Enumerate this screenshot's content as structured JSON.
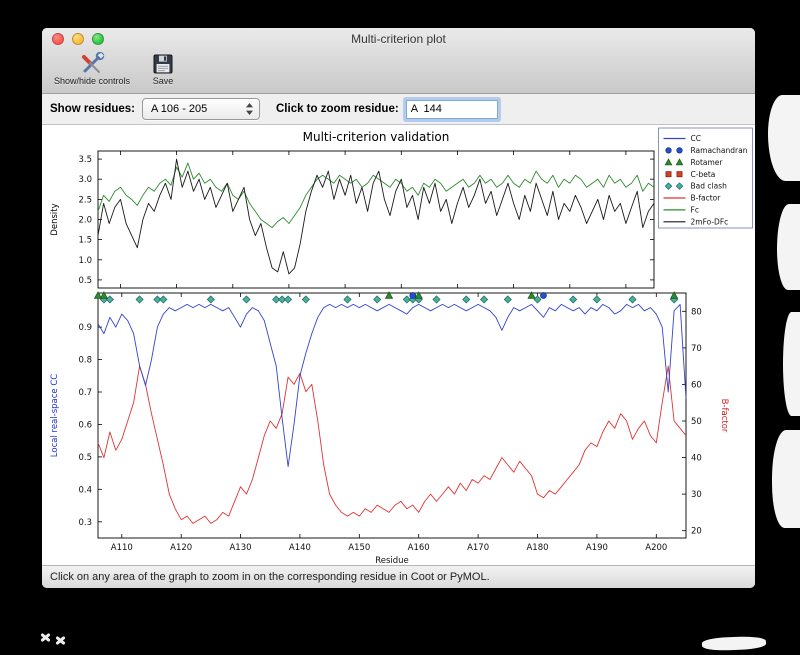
{
  "window": {
    "title": "Multi-criterion plot",
    "status_bar": "Click on any area of the graph to zoom in on the corresponding residue in Coot or PyMOL."
  },
  "toolbar": {
    "show_hide_label": "Show/hide controls",
    "save_label": "Save"
  },
  "icons": {
    "show_hide": "crossed-tools-icon",
    "save": "floppy-disk-icon",
    "popup_stepper": "up-down-chevrons"
  },
  "controls": {
    "show_residues_label": "Show residues:",
    "residue_range_value": "A 106 - 205",
    "zoom_residue_label": "Click to zoom residue:",
    "zoom_residue_value": "A  144"
  },
  "chart_data": {
    "type": "line",
    "title": "Multi-criterion validation",
    "xlabel": "Residue",
    "x_range": [
      106,
      205
    ],
    "x_tick_values": [
      110,
      120,
      130,
      140,
      150,
      160,
      170,
      180,
      190,
      200
    ],
    "x_ticks": [
      "A110",
      "A120",
      "A130",
      "A140",
      "A150",
      "A160",
      "A170",
      "A180",
      "A190",
      "A200"
    ],
    "top_plot": {
      "ylabel": "Density",
      "ylim": [
        0.3,
        3.7
      ],
      "yticks": [
        0.5,
        1.0,
        1.5,
        2.0,
        2.5,
        3.0,
        3.5
      ],
      "series": [
        {
          "name": "Fc",
          "color": "#2e8b2e",
          "values": [
            2.2,
            2.6,
            2.45,
            2.7,
            2.8,
            2.6,
            2.5,
            2.35,
            2.6,
            2.8,
            2.7,
            2.9,
            3.0,
            2.85,
            3.3,
            3.05,
            3.4,
            3.0,
            3.15,
            2.9,
            3.0,
            2.8,
            2.7,
            2.9,
            2.6,
            2.5,
            2.7,
            2.4,
            2.2,
            2.0,
            1.9,
            1.8,
            1.95,
            2.05,
            1.9,
            2.1,
            2.3,
            2.6,
            2.8,
            3.0,
            3.1,
            3.0,
            2.9,
            3.1,
            3.0,
            2.9,
            3.0,
            2.8,
            2.9,
            3.1,
            3.0,
            2.9,
            2.8,
            3.0,
            2.9,
            2.7,
            2.8,
            2.6,
            2.9,
            2.8,
            3.0,
            2.9,
            2.7,
            2.8,
            2.9,
            3.0,
            2.8,
            2.9,
            3.1,
            2.9,
            3.0,
            2.8,
            2.9,
            3.1,
            2.9,
            2.8,
            3.0,
            2.9,
            3.2,
            3.0,
            2.9,
            3.1,
            2.8,
            3.0,
            2.9,
            3.1,
            3.0,
            2.8,
            2.9,
            3.0,
            2.8,
            3.1,
            2.9,
            3.0,
            2.8,
            2.9,
            3.1,
            2.7,
            2.9,
            2.8
          ]
        },
        {
          "name": "2mFo-DFc",
          "color": "#1a1a1a",
          "values": [
            1.6,
            2.4,
            1.9,
            2.3,
            2.5,
            1.9,
            1.6,
            1.3,
            2.0,
            2.4,
            2.2,
            2.6,
            2.9,
            2.5,
            3.5,
            2.8,
            3.2,
            2.7,
            3.0,
            2.5,
            2.8,
            2.3,
            2.6,
            2.9,
            2.2,
            2.5,
            2.8,
            2.0,
            1.6,
            1.9,
            1.3,
            0.8,
            0.7,
            1.2,
            0.65,
            0.8,
            1.4,
            2.2,
            2.7,
            3.1,
            2.8,
            3.2,
            2.5,
            3.0,
            2.6,
            3.1,
            2.4,
            2.8,
            2.2,
            2.9,
            3.2,
            2.5,
            2.1,
            2.7,
            3.0,
            2.3,
            2.6,
            2.0,
            2.8,
            2.4,
            2.9,
            2.2,
            2.5,
            1.9,
            2.4,
            2.8,
            2.3,
            2.6,
            3.0,
            2.4,
            2.7,
            2.1,
            2.5,
            2.9,
            2.4,
            2.0,
            2.6,
            2.2,
            2.9,
            2.5,
            2.1,
            2.7,
            2.0,
            2.4,
            2.2,
            2.6,
            2.3,
            1.9,
            2.2,
            2.5,
            2.0,
            2.6,
            2.2,
            2.4,
            1.9,
            2.3,
            2.7,
            1.8,
            2.2,
            2.4
          ]
        }
      ]
    },
    "bottom_plot": {
      "ylabel_left": "Local real-space CC",
      "ylabel_left_color": "#2233cc",
      "ylim_left": [
        0.25,
        1.005
      ],
      "yticks_left": [
        0.3,
        0.4,
        0.5,
        0.6,
        0.7,
        0.8,
        0.9
      ],
      "ylabel_right": "B-factor",
      "ylabel_right_color": "#cc2222",
      "ylim_right": [
        18,
        85
      ],
      "yticks_right": [
        20,
        30,
        40,
        50,
        60,
        70,
        80
      ],
      "cc": {
        "name": "CC",
        "color": "#3344cc",
        "values": [
          0.91,
          0.88,
          0.93,
          0.9,
          0.94,
          0.92,
          0.88,
          0.78,
          0.72,
          0.8,
          0.9,
          0.94,
          0.96,
          0.95,
          0.96,
          0.97,
          0.96,
          0.97,
          0.96,
          0.97,
          0.96,
          0.95,
          0.96,
          0.93,
          0.9,
          0.94,
          0.96,
          0.95,
          0.92,
          0.85,
          0.78,
          0.62,
          0.47,
          0.6,
          0.75,
          0.82,
          0.88,
          0.93,
          0.96,
          0.97,
          0.96,
          0.97,
          0.96,
          0.97,
          0.96,
          0.97,
          0.96,
          0.95,
          0.96,
          0.97,
          0.96,
          0.95,
          0.94,
          0.96,
          0.97,
          0.96,
          0.95,
          0.96,
          0.97,
          0.96,
          0.97,
          0.96,
          0.95,
          0.96,
          0.97,
          0.96,
          0.95,
          0.93,
          0.89,
          0.93,
          0.96,
          0.95,
          0.96,
          0.97,
          0.95,
          0.93,
          0.96,
          0.95,
          0.97,
          0.96,
          0.95,
          0.96,
          0.94,
          0.96,
          0.95,
          0.97,
          0.96,
          0.94,
          0.95,
          0.97,
          0.96,
          0.97,
          0.95,
          0.96,
          0.94,
          0.9,
          0.7,
          0.95,
          0.97,
          0.68
        ]
      },
      "bfactor": {
        "name": "B-factor",
        "color": "#e03434",
        "values": [
          44,
          40,
          47,
          42,
          45,
          50,
          55,
          65,
          60,
          52,
          45,
          38,
          30,
          26,
          23,
          24,
          22,
          23,
          24,
          22,
          23,
          25,
          24,
          28,
          32,
          30,
          34,
          40,
          46,
          50,
          48,
          52,
          62,
          60,
          63,
          58,
          60,
          50,
          38,
          30,
          27,
          25,
          24,
          25,
          24,
          26,
          25,
          27,
          26,
          25,
          27,
          28,
          26,
          27,
          25,
          28,
          30,
          28,
          30,
          32,
          30,
          33,
          31,
          34,
          33,
          35,
          34,
          37,
          40,
          38,
          36,
          39,
          37,
          35,
          30,
          29,
          31,
          30,
          32,
          34,
          36,
          38,
          42,
          44,
          43,
          47,
          50,
          48,
          52,
          50,
          45,
          48,
          50,
          46,
          44,
          55,
          65,
          50,
          48,
          46
        ]
      },
      "markers": {
        "bad_clash": {
          "shape": "diamond",
          "color": "#4cae9e",
          "edge": "#1e6e63",
          "residues": [
            107,
            108,
            113,
            116,
            117,
            125,
            131,
            136,
            137,
            138,
            141,
            148,
            153,
            158,
            159,
            160,
            163,
            168,
            171,
            175,
            180,
            186,
            190,
            196,
            203
          ]
        },
        "rotamer": {
          "shape": "triangle",
          "color": "#2e8b2e",
          "edge": "#1d5c1d",
          "residues": [
            106,
            107,
            155,
            160,
            179,
            203
          ]
        },
        "ramachandran": {
          "shape": "circle",
          "color": "#2850c8",
          "edge": "#16309a",
          "residues": [
            159,
            181
          ]
        },
        "cbeta": {
          "shape": "square",
          "color": "#cc4422",
          "edge": "#8a2415",
          "residues": []
        }
      }
    },
    "legend": [
      {
        "label": "CC",
        "type": "line",
        "color": "#3344cc"
      },
      {
        "label": "Ramachandran",
        "type": "circle",
        "color": "#2850c8",
        "edge": "#16309a"
      },
      {
        "label": "Rotamer",
        "type": "triangle",
        "color": "#2e8b2e",
        "edge": "#1d5c1d"
      },
      {
        "label": "C-beta",
        "type": "square",
        "color": "#cc4422",
        "edge": "#8a2415"
      },
      {
        "label": "Bad clash",
        "type": "diamond",
        "color": "#4cae9e",
        "edge": "#1e6e63"
      },
      {
        "label": "B-factor",
        "type": "line",
        "color": "#e03434"
      },
      {
        "label": "Fc",
        "type": "line",
        "color": "#2e8b2e"
      },
      {
        "label": "2mFo-DFc",
        "type": "line",
        "color": "#1a1a1a"
      }
    ]
  }
}
